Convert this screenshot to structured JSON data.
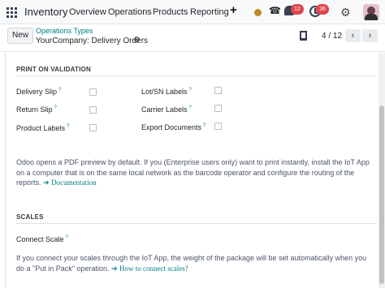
{
  "navbar": {
    "app_name": "Inventory",
    "menu": [
      "Overview",
      "Operations",
      "Products",
      "Reporting"
    ],
    "add_symbol": "+",
    "messages_count": "12",
    "activities_count": "36"
  },
  "control_panel": {
    "new_label": "New",
    "breadcrumb": "Operations Types",
    "record_name": "YourCompany: Delivery Orders",
    "pager": "4 / 12",
    "prev_symbol": "‹",
    "next_symbol": "›"
  },
  "print_section": {
    "title": "PRINT ON VALIDATION",
    "help_mark": "?",
    "fields": [
      {
        "label": "Delivery Slip",
        "checked": false
      },
      {
        "label": "Return Slip",
        "checked": false
      },
      {
        "label": "Product Labels",
        "checked": false
      },
      {
        "label": "Lot/SN Labels",
        "checked": false
      },
      {
        "label": "Carrier Labels",
        "checked": false
      },
      {
        "label": "Export Documents",
        "checked": false
      }
    ],
    "info_text": "Odoo opens a PDF preview by default. If you (Enterprise users only) want to print instantly, install the IoT App on a computer that is on the same local network as the barcode operator and configure the routing of the reports.",
    "link_label": "Documentation"
  },
  "scales_section": {
    "title": "SCALES",
    "field_label": "Connect Scale",
    "info_text": "If you connect your scales through the IoT App, the weight of the package will be set automatically when you do a \"Put in Pack\" operation.",
    "link_label": "How to connect scales?"
  },
  "colors": {
    "accent": "#017e84",
    "badge": "#e0444e",
    "status_dot": "#c0891f"
  },
  "icons": [
    "apps-grid-icon",
    "plus-icon",
    "status-dot-icon",
    "phone-icon",
    "chat-icon",
    "clock-icon",
    "company-switch-icon",
    "avatar",
    "gear-icon",
    "print-icon",
    "chevron-left-icon",
    "chevron-right-icon",
    "arrow-right-icon"
  ]
}
